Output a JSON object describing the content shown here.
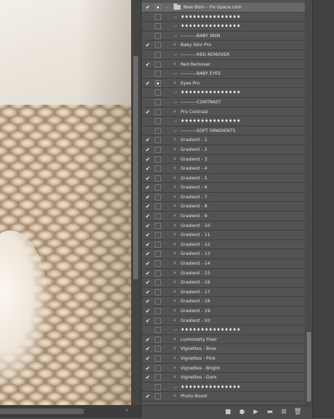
{
  "layers": [
    {
      "eye": true,
      "box": "mask",
      "chevron": "down",
      "folder": true,
      "label": "New Born - Fix-Space.com",
      "indent": 0,
      "selected": true
    },
    {
      "eye": false,
      "box": "none",
      "chevron": "down",
      "label": "♦♦♦♦♦♦♦♦♦♦♦♦♦♦♦",
      "indent": 1
    },
    {
      "eye": false,
      "box": "none",
      "chevron": "down",
      "label": "♦♦♦♦♦♦♦♦♦♦♦♦♦♦♦",
      "indent": 1
    },
    {
      "eye": false,
      "box": "none",
      "chevron": "down",
      "label": "----------BABY SKIN",
      "indent": 1
    },
    {
      "eye": true,
      "box": "none",
      "chevron": "right",
      "label": "Baby Skin Pro",
      "indent": 1
    },
    {
      "eye": false,
      "box": "none",
      "chevron": "down",
      "label": "----------RED REMOVER",
      "indent": 1
    },
    {
      "eye": true,
      "box": "none",
      "chevron": "right",
      "label": "Red Remover",
      "indent": 1
    },
    {
      "eye": false,
      "box": "none",
      "chevron": "down",
      "label": "----------BABY EYES",
      "indent": 1
    },
    {
      "eye": true,
      "box": "mask",
      "chevron": "right",
      "label": "Eyes Pro",
      "indent": 1
    },
    {
      "eye": false,
      "box": "none",
      "chevron": "down",
      "label": "♦♦♦♦♦♦♦♦♦♦♦♦♦♦♦",
      "indent": 1
    },
    {
      "eye": false,
      "box": "none",
      "chevron": "down",
      "label": "----------CONTRAST",
      "indent": 1
    },
    {
      "eye": true,
      "box": "none",
      "chevron": "right",
      "label": "Pro Contrast",
      "indent": 1
    },
    {
      "eye": false,
      "box": "none",
      "chevron": "down",
      "label": "♦♦♦♦♦♦♦♦♦♦♦♦♦♦♦",
      "indent": 1
    },
    {
      "eye": false,
      "box": "none",
      "chevron": "down",
      "label": "----------SOFT GRADIENTS",
      "indent": 1
    },
    {
      "eye": true,
      "box": "none",
      "chevron": "right",
      "label": "Gradient - 1",
      "indent": 1
    },
    {
      "eye": true,
      "box": "none",
      "chevron": "right",
      "label": "Gradient - 2",
      "indent": 1
    },
    {
      "eye": true,
      "box": "none",
      "chevron": "right",
      "label": "Gradient - 3",
      "indent": 1
    },
    {
      "eye": true,
      "box": "none",
      "chevron": "right",
      "label": "Gradient - 4",
      "indent": 1
    },
    {
      "eye": true,
      "box": "none",
      "chevron": "right",
      "label": "Gradient - 5",
      "indent": 1
    },
    {
      "eye": true,
      "box": "none",
      "chevron": "right",
      "label": "Gradient - 6",
      "indent": 1
    },
    {
      "eye": true,
      "box": "none",
      "chevron": "right",
      "label": "Gradient - 7",
      "indent": 1
    },
    {
      "eye": true,
      "box": "none",
      "chevron": "right",
      "label": "Gradient - 8",
      "indent": 1
    },
    {
      "eye": true,
      "box": "none",
      "chevron": "right",
      "label": "Gradient - 9",
      "indent": 1
    },
    {
      "eye": true,
      "box": "none",
      "chevron": "right",
      "label": "Gradient - 10",
      "indent": 1
    },
    {
      "eye": true,
      "box": "none",
      "chevron": "right",
      "label": "Gradient - 11",
      "indent": 1
    },
    {
      "eye": true,
      "box": "none",
      "chevron": "right",
      "label": "Gradient - 12",
      "indent": 1
    },
    {
      "eye": true,
      "box": "none",
      "chevron": "right",
      "label": "Gradient - 13",
      "indent": 1
    },
    {
      "eye": true,
      "box": "none",
      "chevron": "right",
      "label": "Gradient - 14",
      "indent": 1
    },
    {
      "eye": true,
      "box": "none",
      "chevron": "right",
      "label": "Gradient - 15",
      "indent": 1
    },
    {
      "eye": true,
      "box": "none",
      "chevron": "right",
      "label": "Gradient - 16",
      "indent": 1
    },
    {
      "eye": true,
      "box": "none",
      "chevron": "right",
      "label": "Gradient - 17",
      "indent": 1
    },
    {
      "eye": true,
      "box": "none",
      "chevron": "right",
      "label": "Gradient - 18",
      "indent": 1
    },
    {
      "eye": true,
      "box": "none",
      "chevron": "right",
      "label": "Gradient - 19",
      "indent": 1
    },
    {
      "eye": true,
      "box": "none",
      "chevron": "right",
      "label": "Gradient - 20",
      "indent": 1
    },
    {
      "eye": false,
      "box": "none",
      "chevron": "down",
      "label": "♦♦♦♦♦♦♦♦♦♦♦♦♦♦♦",
      "indent": 1
    },
    {
      "eye": true,
      "box": "none",
      "chevron": "right",
      "label": "Luminosity Fixer",
      "indent": 1
    },
    {
      "eye": true,
      "box": "none",
      "chevron": "right",
      "label": "Vignettes - Blue",
      "indent": 1
    },
    {
      "eye": true,
      "box": "none",
      "chevron": "right",
      "label": "Vignettes - Pink",
      "indent": 1
    },
    {
      "eye": true,
      "box": "none",
      "chevron": "right",
      "label": "Vignettes - Bright",
      "indent": 1
    },
    {
      "eye": true,
      "box": "none",
      "chevron": "right",
      "label": "Vignettes - Dark",
      "indent": 1
    },
    {
      "eye": false,
      "box": "none",
      "chevron": "down",
      "label": "♦♦♦♦♦♦♦♦♦♦♦♦♦♦♦",
      "indent": 1
    },
    {
      "eye": true,
      "box": "none",
      "chevron": "right",
      "label": "Photo Boost",
      "indent": 1
    }
  ],
  "footer_icons": [
    {
      "name": "fill-adjustment-icon",
      "glyph": "■"
    },
    {
      "name": "circle-adjustment-icon",
      "glyph": "●"
    },
    {
      "name": "group-arrow-icon",
      "glyph": "▶"
    },
    {
      "name": "new-folder-icon",
      "glyph": "▬"
    },
    {
      "name": "new-layer-icon",
      "glyph": "⊞"
    },
    {
      "name": "trash-icon",
      "glyph": "🗑"
    }
  ]
}
